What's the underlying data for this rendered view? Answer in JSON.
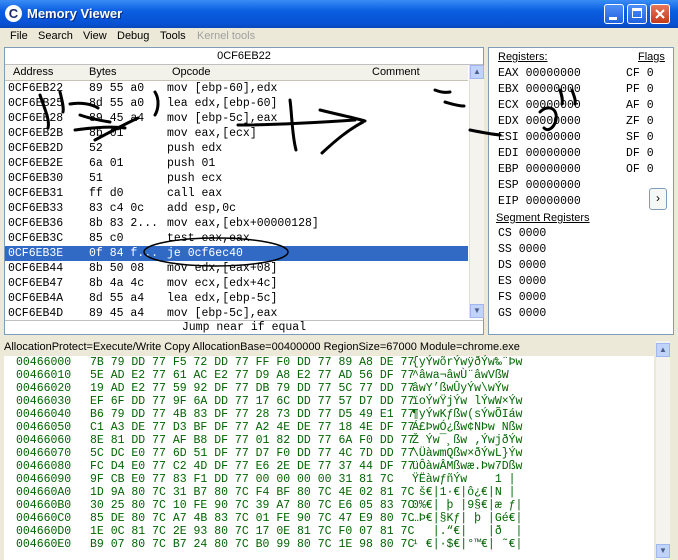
{
  "window": {
    "title": "Memory Viewer",
    "icon": "cheat-engine-icon"
  },
  "menu": [
    "File",
    "Search",
    "View",
    "Debug",
    "Tools",
    "Kernel tools"
  ],
  "disasm": {
    "address_header": "0CF6EB22",
    "columns": [
      "Address",
      "Bytes",
      "Opcode",
      "Comment"
    ],
    "rows": [
      {
        "addr": "0CF6EB22",
        "bytes": "89 55 a0",
        "opcode": "mov [ebp-60],edx"
      },
      {
        "addr": "0CF6EB25",
        "bytes": "8d 55 a0",
        "opcode": "lea edx,[ebp-60]"
      },
      {
        "addr": "0CF6EB28",
        "bytes": "89 45 a4",
        "opcode": "mov [ebp-5c],eax"
      },
      {
        "addr": "0CF6EB2B",
        "bytes": "8b 01",
        "opcode": "mov eax,[ecx]"
      },
      {
        "addr": "0CF6EB2D",
        "bytes": "52",
        "opcode": "push edx"
      },
      {
        "addr": "0CF6EB2E",
        "bytes": "6a 01",
        "opcode": "push 01"
      },
      {
        "addr": "0CF6EB30",
        "bytes": "51",
        "opcode": "push ecx"
      },
      {
        "addr": "0CF6EB31",
        "bytes": "ff d0",
        "opcode": "call eax"
      },
      {
        "addr": "0CF6EB33",
        "bytes": "83 c4 0c",
        "opcode": "add esp,0c"
      },
      {
        "addr": "0CF6EB36",
        "bytes": "8b 83 2...",
        "opcode": "mov eax,[ebx+00000128]"
      },
      {
        "addr": "0CF6EB3C",
        "bytes": "85 c0",
        "opcode": "test eax,eax"
      },
      {
        "addr": "0CF6EB3E",
        "bytes": "0f 84 f...",
        "opcode": "je 0cf6ec40",
        "selected": true
      },
      {
        "addr": "0CF6EB44",
        "bytes": "8b 50 08",
        "opcode": "mov edx,[eax+08]"
      },
      {
        "addr": "0CF6EB47",
        "bytes": "8b 4a 4c",
        "opcode": "mov ecx,[edx+4c]"
      },
      {
        "addr": "0CF6EB4A",
        "bytes": "8d 55 a4",
        "opcode": "lea edx,[ebp-5c]"
      },
      {
        "addr": "0CF6EB4D",
        "bytes": "89 45 a4",
        "opcode": "mov [ebp-5c],eax"
      }
    ],
    "status": "Jump near if equal"
  },
  "registers": {
    "label": "Registers:",
    "flags_label": "Flags",
    "segment_label": "Segment Registers",
    "regs": [
      {
        "name": "EAX",
        "value": "00000000"
      },
      {
        "name": "EBX",
        "value": "00000000"
      },
      {
        "name": "ECX",
        "value": "00000000"
      },
      {
        "name": "EDX",
        "value": "00000000"
      },
      {
        "name": "ESI",
        "value": "00000000"
      },
      {
        "name": "EDI",
        "value": "00000000"
      },
      {
        "name": "EBP",
        "value": "00000000"
      },
      {
        "name": "ESP",
        "value": "00000000"
      },
      {
        "name": "EIP",
        "value": "00000000"
      }
    ],
    "flags": [
      {
        "name": "CF",
        "value": "0"
      },
      {
        "name": "PF",
        "value": "0"
      },
      {
        "name": "AF",
        "value": "0"
      },
      {
        "name": "ZF",
        "value": "0"
      },
      {
        "name": "SF",
        "value": "0"
      },
      {
        "name": "DF",
        "value": "0"
      },
      {
        "name": "OF",
        "value": "0"
      }
    ],
    "segments": [
      {
        "name": "CS",
        "value": "0000"
      },
      {
        "name": "SS",
        "value": "0000"
      },
      {
        "name": "DS",
        "value": "0000"
      },
      {
        "name": "ES",
        "value": "0000"
      },
      {
        "name": "FS",
        "value": "0000"
      },
      {
        "name": "GS",
        "value": "0000"
      }
    ],
    "expand_glyph": "›"
  },
  "info_bar": "AllocationProtect=Execute/Write Copy  AllocationBase=00400000 RegionSize=67000 Module=chrome.exe",
  "hex": [
    {
      "addr": "00466000",
      "bytes": "7B 79 DD 77 F5 72 DD 77 FF F0 DD 77 89 A8 DE 77",
      "ascii": "{yÝwõrÝwÿðÝw‰¨Þw"
    },
    {
      "addr": "00466010",
      "bytes": "5E AD E2 77 61 AC E2 77 D9 A8 E2 77 AD 56 DF 77",
      "ascii": "^­âwa¬âwÙ¨âw­VßW"
    },
    {
      "addr": "00466020",
      "bytes": "19 AD E2 77 59 92 DF 77 DB 79 DD 77 5C 77 DD 77",
      "ascii": "­âwY’ßwÛyÝw\\wÝw"
    },
    {
      "addr": "00466030",
      "bytes": "EF 6F DD 77 9F 6A DD 77 17 6C DD 77 57 D7 DD 77",
      "ascii": "ïoÝwŸjÝw lÝwW×Ýw"
    },
    {
      "addr": "00466040",
      "bytes": "B6 79 DD 77 4B 83 DF 77 28 73 DD 77 D5 49 E1 77",
      "ascii": "¶yÝwKƒßw(sÝwÕIáw"
    },
    {
      "addr": "00466050",
      "bytes": "C1 A3 DE 77 D3 BF DF 77 A2 4E DE 77 18 4E DF 77",
      "ascii": "Á£ÞwÓ¿ßw¢NÞw Nßw"
    },
    {
      "addr": "00466060",
      "bytes": "8E 81 DD 77 AF B8 DF 77 01 82 DD 77 6A F0 DD 77",
      "ascii": "Ž Ýw¯¸ßw ‚ÝwjðÝw"
    },
    {
      "addr": "00466070",
      "bytes": "5C DC E0 77 6D 51 DF 77 D7 F0 DD 77 4C 7D DD 77",
      "ascii": "\\ÜàwmQßw×ðÝwL}Ýw"
    },
    {
      "addr": "00466080",
      "bytes": "FC D4 E0 77 C2 4D DF 77 E6 2E DE 77 37 44 DF 77",
      "ascii": "üÔàwÂMßwæ.Þw7Dßw"
    },
    {
      "addr": "00466090",
      "bytes": "9F CB E0 77 83 F1 DD 77 00 00 00 00 31 81 7C",
      "ascii": "ŸËàwƒñÝw    1 |"
    },
    {
      "addr": "004660A0",
      "bytes": "1D 9A 80 7C 31 B7 80 7C F4 BF 80 7C 4E 02 81 7C",
      "ascii": " š€|1·€|ô¿€|N |"
    },
    {
      "addr": "004660B0",
      "bytes": "30 25 80 7C 10 FE 90 7C 39 A7 80 7C E6 05 83 7C",
      "ascii": "0%€| þ |9§€|æ ƒ|"
    },
    {
      "addr": "004660C0",
      "bytes": "85 DE 80 7C A7 4B 83 7C 01 FE 90 7C 47 E9 80 7C",
      "ascii": "…Þ€|§Kƒ| þ |Gé€|"
    },
    {
      "addr": "004660D0",
      "bytes": "1E 0C 81 7C 2E 93 80 7C 17 0E 81 7C F0 07 81 7C",
      "ascii": "   |.“€|   |ð  |"
    },
    {
      "addr": "004660E0",
      "bytes": "B9 07 80 7C B7 24 80 7C B0 99 80 7C 1E 98 80 7C",
      "ascii": "¹ €|·$€|°™€| ˜€|"
    }
  ]
}
